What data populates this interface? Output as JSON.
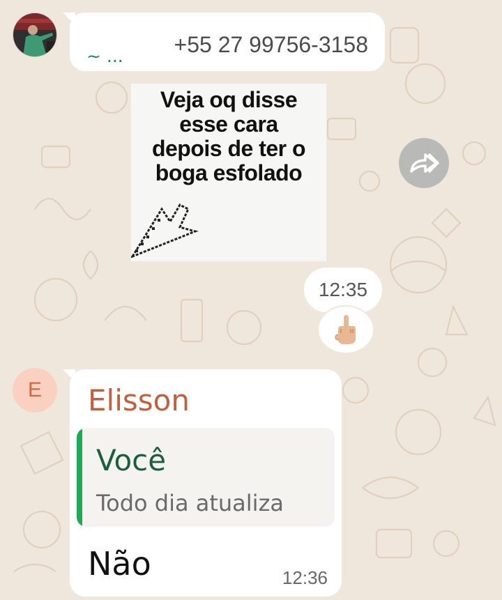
{
  "messages": {
    "forwarded": {
      "sender_alias": "~ ...",
      "sender_phone": "+55 27 99756-3158",
      "sticker_text": "Veja oq disse\nesse cara\ndepois de ter o\nboga esfolado",
      "time": "12:35",
      "reaction": "🖕🏼"
    },
    "reply": {
      "avatar_letter": "E",
      "sender_name": "Elisson",
      "quoted_author": "Você",
      "quoted_text": "Todo dia atualiza",
      "text": "Não",
      "time": "12:36"
    }
  },
  "icons": {
    "avatar": "profile-photo",
    "forward": "forward-icon",
    "sticker_cursor": "cursor-icon"
  },
  "colors": {
    "wallpaper": "#efe7dc",
    "bubble": "#ffffff",
    "alias_green": "#24866a",
    "name_orange": "#c0603e",
    "quote_bar": "#1fa855",
    "quote_author": "#1b5e3d",
    "forward_button": "#b9b9b7",
    "avatar_bg": "#fad1c0"
  }
}
